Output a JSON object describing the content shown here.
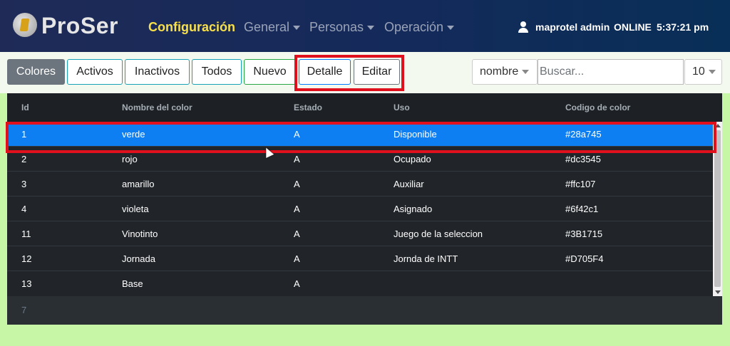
{
  "header": {
    "brand": "ProSer",
    "nav": [
      {
        "label": "Configuración",
        "active": true,
        "dropdown": false
      },
      {
        "label": "General",
        "active": false,
        "dropdown": true
      },
      {
        "label": "Personas",
        "active": false,
        "dropdown": true
      },
      {
        "label": "Operación",
        "active": false,
        "dropdown": true
      }
    ],
    "user": "maprotel admin",
    "status": "ONLINE",
    "time": "5:37:21 pm"
  },
  "toolbar": {
    "buttons": [
      {
        "label": "Colores",
        "variant": "secondary"
      },
      {
        "label": "Activos",
        "variant": "info"
      },
      {
        "label": "Inactivos",
        "variant": "info"
      },
      {
        "label": "Todos",
        "variant": "info"
      },
      {
        "label": "Nuevo",
        "variant": "success"
      },
      {
        "label": "Detalle",
        "variant": "primary"
      },
      {
        "label": "Editar",
        "variant": "warn"
      }
    ],
    "sort_select": "nombre",
    "search_placeholder": "Buscar...",
    "page_size": "10"
  },
  "table": {
    "columns": [
      "Id",
      "Nombre del color",
      "Estado",
      "Uso",
      "Codigo de color"
    ],
    "rows": [
      {
        "id": "1",
        "nombre": "verde",
        "estado": "A",
        "uso": "Disponible",
        "codigo": "#28a745",
        "selected": true
      },
      {
        "id": "2",
        "nombre": "rojo",
        "estado": "A",
        "uso": "Ocupado",
        "codigo": "#dc3545",
        "selected": false
      },
      {
        "id": "3",
        "nombre": "amarillo",
        "estado": "A",
        "uso": "Auxiliar",
        "codigo": "#ffc107",
        "selected": false
      },
      {
        "id": "4",
        "nombre": "violeta",
        "estado": "A",
        "uso": "Asignado",
        "codigo": "#6f42c1",
        "selected": false
      },
      {
        "id": "11",
        "nombre": "Vinotinto",
        "estado": "A",
        "uso": "Juego de la seleccion",
        "codigo": "#3B1715",
        "selected": false
      },
      {
        "id": "12",
        "nombre": "Jornada",
        "estado": "A",
        "uso": "Jornda de INTT",
        "codigo": "#D705F4",
        "selected": false
      },
      {
        "id": "13",
        "nombre": "Base",
        "estado": "A",
        "uso": "",
        "codigo": "",
        "selected": false
      }
    ],
    "count": "7"
  },
  "colors": {
    "nav_active": "#f7e04a",
    "selected_row": "#0d7ff2",
    "highlight": "#e0111c",
    "page_background": "#c6f6a6"
  }
}
